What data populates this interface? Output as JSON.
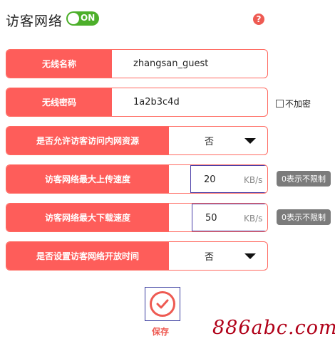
{
  "header": {
    "title": "访客网络",
    "toggle_label": "ON",
    "help_symbol": "?"
  },
  "form": {
    "ssid": {
      "label": "无线名称",
      "value": "zhangsan_guest"
    },
    "password": {
      "label": "无线密码",
      "value": "1a2b3c4d",
      "no_encrypt_label": "不加密"
    },
    "internal_access": {
      "label": "是否允许访客访问内网资源",
      "value": "否"
    },
    "upload": {
      "label": "访客网络最大上传速度",
      "value": "20",
      "unit": "KB/s",
      "hint": "0表示不限制"
    },
    "download": {
      "label": "访客网络最大下载速度",
      "value": "50",
      "unit": "KB/s",
      "hint": "0表示不限制"
    },
    "open_time": {
      "label": "是否设置访客网络开放时间",
      "value": "否"
    }
  },
  "save": {
    "label": "保存"
  },
  "watermark": "886abc.com",
  "colors": {
    "accent": "#fe5d5a",
    "toggle_on": "#4caf2a",
    "hint_bg": "#7b7b7b",
    "watermark": "#b00018"
  }
}
